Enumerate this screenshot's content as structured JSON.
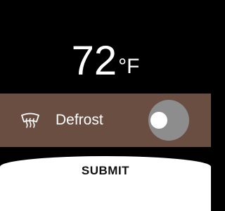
{
  "temperature": {
    "value": "72",
    "unit": "°F"
  },
  "defrost": {
    "icon": "defrost-icon",
    "label": "Defrost",
    "toggle_on": true
  },
  "submit": {
    "label": "SUBMIT"
  },
  "colors": {
    "background": "#000000",
    "row_background": "#6b4e42",
    "toggle_halo": "#8d8d8d",
    "toggle_thumb": "#ffffff",
    "submit_background": "#ffffff"
  }
}
